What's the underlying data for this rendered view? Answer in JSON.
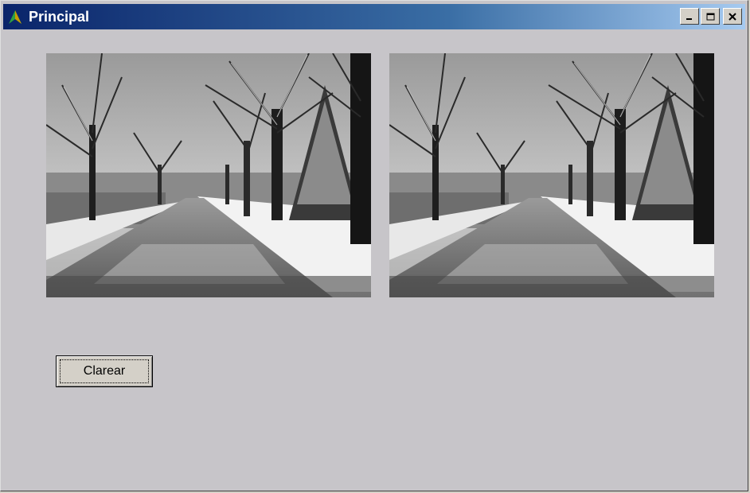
{
  "window": {
    "title": "Principal",
    "controls": [
      "minimize-icon",
      "maximize-icon",
      "close-icon"
    ]
  },
  "images": [
    {
      "name": "original-image",
      "content": "black and white snowy tree-lined road"
    },
    {
      "name": "processed-image",
      "content": "black and white snowy tree-lined road"
    }
  ],
  "buttons": {
    "clear_label": "Clarear"
  },
  "colors": {
    "titlebar_start": "#0a246a",
    "titlebar_end": "#a6caf0",
    "form_background": "#c7c5c9"
  }
}
